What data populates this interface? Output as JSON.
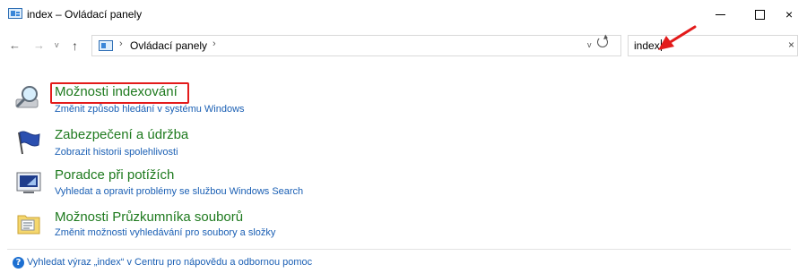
{
  "window": {
    "title": "index – Ovládací panely",
    "close_glyph": "×"
  },
  "nav": {
    "back_glyph": "←",
    "forward_glyph": "→",
    "history_glyph": "v",
    "up_glyph": "↑",
    "breadcrumb_separator": "›",
    "breadcrumb": "Ovládací panely",
    "dropdown_glyph": "v"
  },
  "search": {
    "value": "index",
    "clear_glyph": "×"
  },
  "results": [
    {
      "title": "Možnosti indexování",
      "subtitle": "Změnit způsob hledání v systému Windows",
      "icon": "magnifier-icon"
    },
    {
      "title": "Zabezpečení a údržba",
      "subtitle": "Zobrazit historii spolehlivosti",
      "icon": "flag-icon"
    },
    {
      "title": "Poradce při potížích",
      "subtitle": "Vyhledat a opravit problémy se službou Windows Search",
      "icon": "troubleshooter-icon"
    },
    {
      "title": "Možnosti Průzkumníka souborů",
      "subtitle": "Změnit možnosti vyhledávání pro soubory a složky",
      "icon": "folder-options-icon"
    }
  ],
  "help": {
    "icon_glyph": "?",
    "text": "Vyhledat výraz „index“ v Centru pro nápovědu a odbornou pomoc"
  },
  "colors": {
    "title_green": "#1e7a1e",
    "link_blue": "#1a5fb4",
    "annotation_red": "#e31b1b"
  }
}
